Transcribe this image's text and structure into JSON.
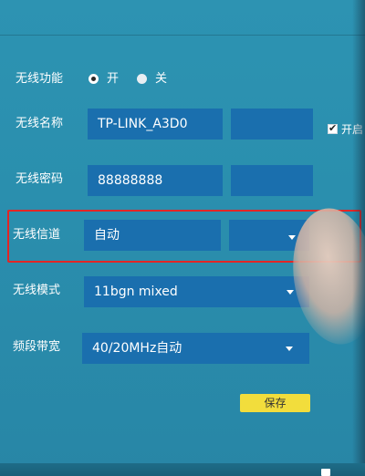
{
  "form": {
    "wireless_function": {
      "label": "无线功能",
      "options": [
        {
          "label": "开",
          "selected": true
        },
        {
          "label": "关",
          "selected": false
        }
      ]
    },
    "ssid": {
      "label": "无线名称",
      "value": "TP-LINK_A3D0",
      "checkbox_label": "开启"
    },
    "password": {
      "label": "无线密码",
      "value": "88888888"
    },
    "channel": {
      "label": "无线信道",
      "value": "自动"
    },
    "mode": {
      "label": "无线模式",
      "value": "11bgn mixed"
    },
    "bandwidth": {
      "label": "频段带宽",
      "value": "40/20MHz自动"
    },
    "save_label": "保存"
  },
  "colors": {
    "background": "#2a8fae",
    "field": "#1a6fae",
    "highlight": "#e32525",
    "save_button": "#f2dd3c"
  }
}
